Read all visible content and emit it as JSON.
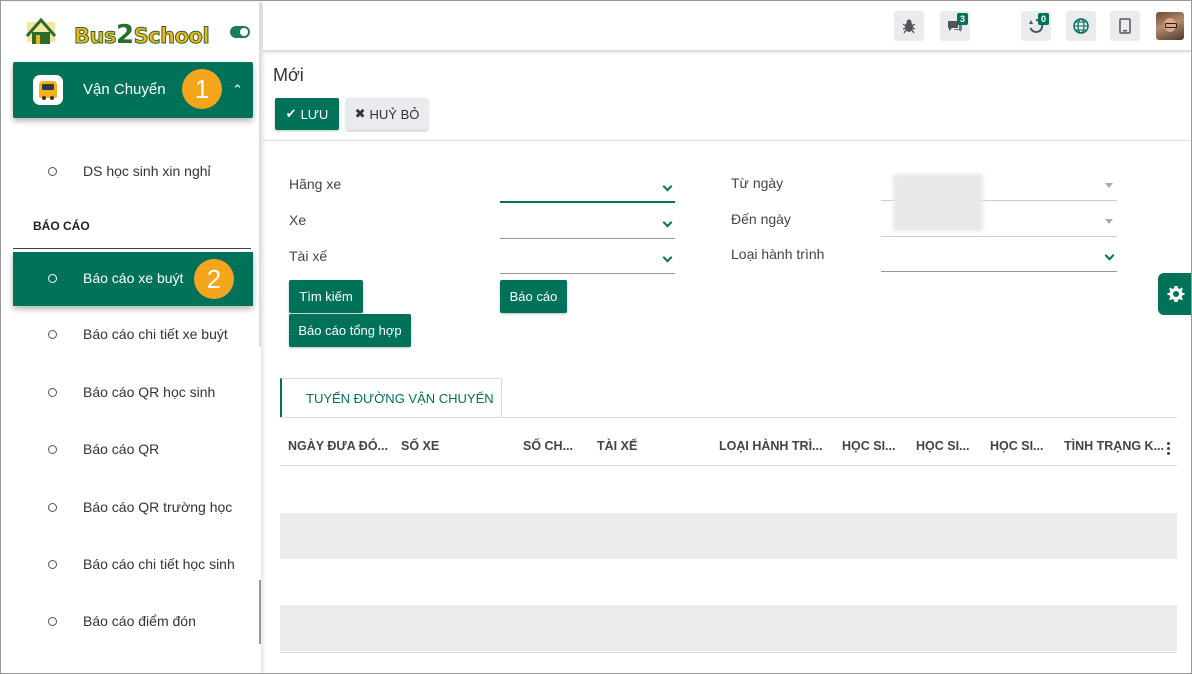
{
  "brand": {
    "logo_text_a": "Bus",
    "logo_text_b": "2",
    "logo_text_c": "School"
  },
  "sidebar": {
    "group_label": "Vận Chuyển",
    "group_badge": "1",
    "top_item": "DS học sinh xin nghỉ",
    "section_title": "BÁO CÁO",
    "active_badge": "2",
    "items": [
      "Báo cáo xe buýt",
      "Báo cáo chi tiết xe buýt",
      "Báo cáo QR học sinh",
      "Báo cáo QR",
      "Báo cáo QR trường học",
      "Báo cáo chi tiết học sinh",
      "Báo cáo điểm đón"
    ]
  },
  "topbar": {
    "messages_count": "3",
    "activity_count": "0"
  },
  "page": {
    "title": "Mới",
    "save_label": "LƯU",
    "cancel_label": "HUỶ BỎ"
  },
  "form": {
    "hang_xe": "Hãng xe",
    "xe": "Xe",
    "tai_xe": "Tài xế",
    "tu_ngay": "Từ ngày",
    "den_ngay": "Đến ngày",
    "loai_hanh_trinh": "Loại hành trình",
    "search_btn": "Tìm kiếm",
    "report_btn": "Báo cáo",
    "summary_btn": "Báo cáo tổng hợp"
  },
  "tab_label": "TUYẾN ĐƯỜNG VẬN CHUYỂN",
  "table": {
    "columns": [
      "NGÀY ĐƯA ĐÓ...",
      "SỐ XE",
      "SỐ CH...",
      "TÀI XẾ",
      "LOẠI HÀNH TRÌ...",
      "HỌC SI...",
      "HỌC SI...",
      "HỌC SI...",
      "TÌNH TRẠNG K..."
    ]
  },
  "colors": {
    "primary": "#00725a",
    "badge": "#f5a51c"
  }
}
